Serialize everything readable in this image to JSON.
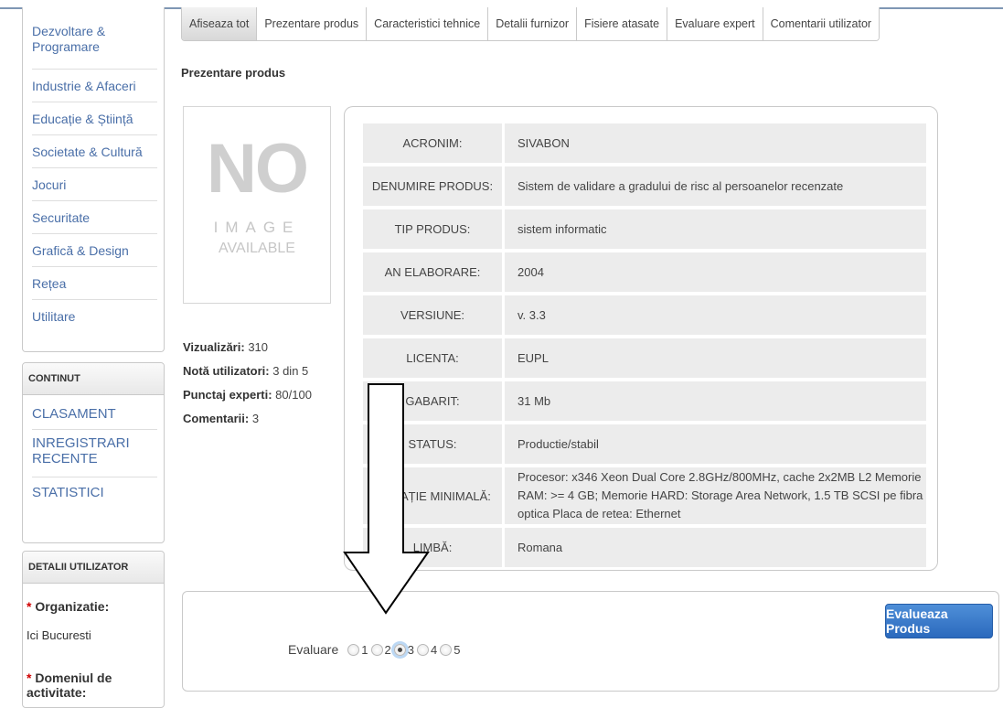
{
  "sidebar": {
    "categories": [
      "Dezvoltare & Programare",
      "Industrie & Afaceri",
      "Educație & Știință",
      "Societate & Cultură",
      "Jocuri",
      "Securitate",
      "Grafică & Design",
      "Rețea",
      "Utilitare"
    ],
    "continut": {
      "title": "CONTINUT",
      "items": [
        "CLASAMENT",
        "INREGISTRARI RECENTE",
        "STATISTICI"
      ]
    },
    "user_details": {
      "title": "DETALII UTILIZATOR",
      "organization_label": "Organizatie:",
      "organization_value": "Ici Bucuresti",
      "domain_label": "Domeniul de activitate:"
    }
  },
  "tabs": [
    "Afiseaza tot",
    "Prezentare produs",
    "Caracteristici tehnice",
    "Detalii furnizor",
    "Fisiere atasate",
    "Evaluare expert",
    "Comentarii utilizator"
  ],
  "active_tab": 0,
  "section_title": "Prezentare produs",
  "no_image": {
    "line1": "NO",
    "line2": "IMAGE",
    "line3": "AVAILABLE"
  },
  "stats": {
    "views_label": "Vizualizări:",
    "views_value": "310",
    "rating_label": "Notă utilizatori:",
    "rating_value": "3 din 5",
    "experts_label": "Punctaj experti:",
    "experts_value": "80/100",
    "comments_label": "Comentarii:",
    "comments_value": "3"
  },
  "product": [
    {
      "key": "ACRONIM:",
      "value": "SIVABON"
    },
    {
      "key": "DENUMIRE PRODUS:",
      "value": "Sistem de validare a gradului de risc al persoanelor recenzate"
    },
    {
      "key": "TIP PRODUS:",
      "value": "sistem informatic"
    },
    {
      "key": "AN ELABORARE:",
      "value": "2004"
    },
    {
      "key": "VERSIUNE:",
      "value": "v. 3.3"
    },
    {
      "key": "LICENTA:",
      "value": "EUPL"
    },
    {
      "key": "GABARIT:",
      "value": "31 Mb"
    },
    {
      "key": "STATUS:",
      "value": "Productie/stabil"
    },
    {
      "key": "GURAȚIE MINIMALĂ:",
      "value": "Procesor: x346 Xeon Dual Core 2.8GHz/800MHz, cache 2x2MB L2 Memorie RAM: >= 4 GB; Memorie HARD: Storage Area Network, 1.5 TB SCSI pe fibra optica Placa de retea: Ethernet"
    },
    {
      "key": "LIMBĂ:",
      "value": "Romana"
    }
  ],
  "evaluation": {
    "label": "Evaluare",
    "options": [
      "1",
      "2",
      "3",
      "4",
      "5"
    ],
    "selected": "3",
    "button": "Evalueaza Produs"
  },
  "colors": {
    "link": "#4a6fa8",
    "button": "#2b69bd",
    "required": "#d00000"
  }
}
